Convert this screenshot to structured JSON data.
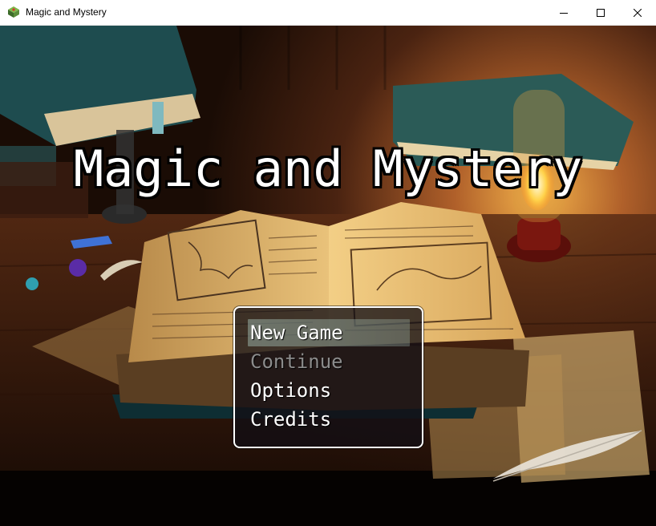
{
  "window": {
    "title": "Magic and Mystery",
    "icon": "rpg-maker-app-icon",
    "controls": [
      "minimize-icon",
      "maximize-icon",
      "close-icon"
    ]
  },
  "game": {
    "title": "Magic and Mystery",
    "menu": {
      "items": [
        {
          "label": "New Game",
          "selected": true,
          "enabled": true
        },
        {
          "label": "Continue",
          "selected": false,
          "enabled": false
        },
        {
          "label": "Options",
          "selected": false,
          "enabled": true
        },
        {
          "label": "Credits",
          "selected": false,
          "enabled": true
        }
      ]
    }
  },
  "colors": {
    "title_text": "#ffffff",
    "title_outline": "#000000",
    "menu_background": "#120e14",
    "menu_border": "#ffffff",
    "selection_highlight": "#aac8be",
    "disabled_text": "#8c8c8c"
  }
}
